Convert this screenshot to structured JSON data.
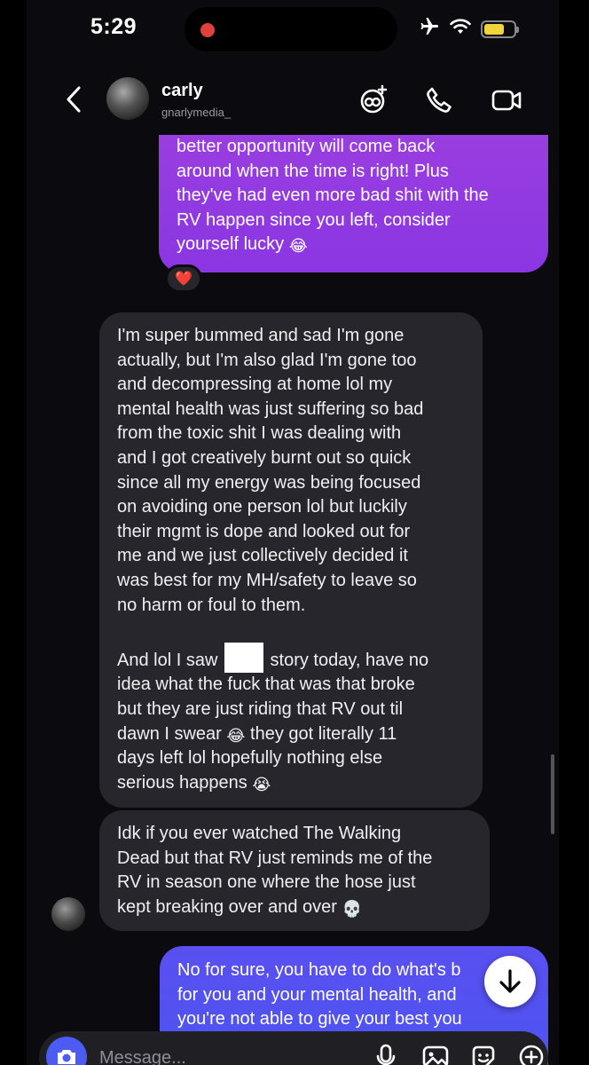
{
  "status_bar": {
    "time": "5:29"
  },
  "header": {
    "name": "carly",
    "handle": "gnarlymedia_"
  },
  "messages": {
    "m1": {
      "lines": [
        "better opportunity will come back",
        "around when the time is right! Plus",
        "they've had even more bad shit with the",
        "RV happen since you left, consider",
        "yourself lucky"
      ],
      "emoji": "😂",
      "reaction": "❤️"
    },
    "m2": {
      "lines": [
        "I'm super bummed and sad I'm gone",
        "actually, but I'm also glad I'm gone too",
        "and decompressing at home lol my",
        "mental health was just suffering so bad",
        "from the toxic shit I was dealing with",
        "and I got creatively burnt out so quick",
        "since all my energy was being focused",
        "on avoiding one person lol but luckily",
        "their mgmt is dope and looked out for",
        "me and we just collectively decided it",
        "was best for my MH/safety to leave so",
        "no harm or foul to them."
      ],
      "p2_l1a": "And lol I saw",
      "p2_l1b": "story today, have no",
      "p2_l2": "idea what the fuck that was that broke",
      "p2_l3": "but they are just riding that RV out til",
      "p2_l4a": "dawn I swear",
      "emoji_a": "😂",
      "p2_l4b": "they got literally 11",
      "p2_l5": "days left lol hopefully nothing else",
      "p2_l6": "serious happens",
      "emoji_b": "😭"
    },
    "m3": {
      "lines": [
        "Idk if you ever watched The Walking",
        "Dead but that RV just reminds me of the",
        "RV in season one where the hose just",
        "kept breaking over and over"
      ],
      "emoji": "💀"
    },
    "m4": {
      "lines": [
        "No for sure, you have to do what's b",
        "for you and your mental health, and",
        "you're not able to give your best you"
      ]
    }
  },
  "composer": {
    "placeholder": "Message..."
  },
  "colors": {
    "outgoing_purple": "#9b3fe0",
    "outgoing_blue": "#5a4ff0",
    "incoming": "#26262c",
    "camera": "#4c5cf2"
  }
}
